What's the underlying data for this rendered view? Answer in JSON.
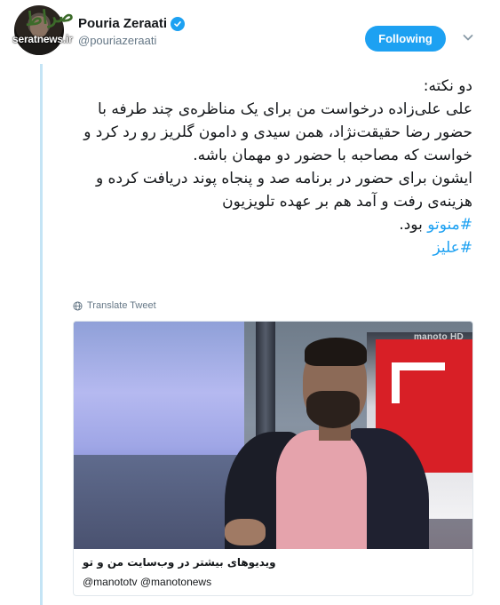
{
  "user": {
    "display_name": "Pouria Zeraati",
    "handle": "@pouriazeraati",
    "verified": true
  },
  "watermark": {
    "logo_text": "صراط",
    "site": "seratnews.ir"
  },
  "follow_button": {
    "label": "Following"
  },
  "tweet": {
    "paragraphs": [
      "دو نکته:",
      "علی علی‌زاده درخواست من برای یک مناظره‌ی چند طرفه با حضور رضا حقیقت‌نژاد، همن سیدی و دامون گلریز رو رد کرد و خواست که مصاحبه با حضور دو مهمان باشه.",
      "ایشون برای حضور در برنامه صد و پنجاه پوند دریافت کرده و هزینه‌ی رفت و آمد هم بر عهده تلویزیون"
    ],
    "hashtag_1": "#منوتو",
    "after_hashtag_1": " بود.",
    "hashtag_2": "#علیز"
  },
  "translate_label": "Translate Tweet",
  "card": {
    "tv_logo": "manoto HD",
    "title": "ویدیوهای بیشتر در وب‌سایت من و تو",
    "subtitle": "@manototv @manotonews"
  },
  "colors": {
    "accent": "#1da1f2",
    "thread_line": "#c4e4f5",
    "secondary_text": "#657786"
  },
  "icons": [
    "verified-badge-icon",
    "chevron-down-icon",
    "globe-icon"
  ]
}
